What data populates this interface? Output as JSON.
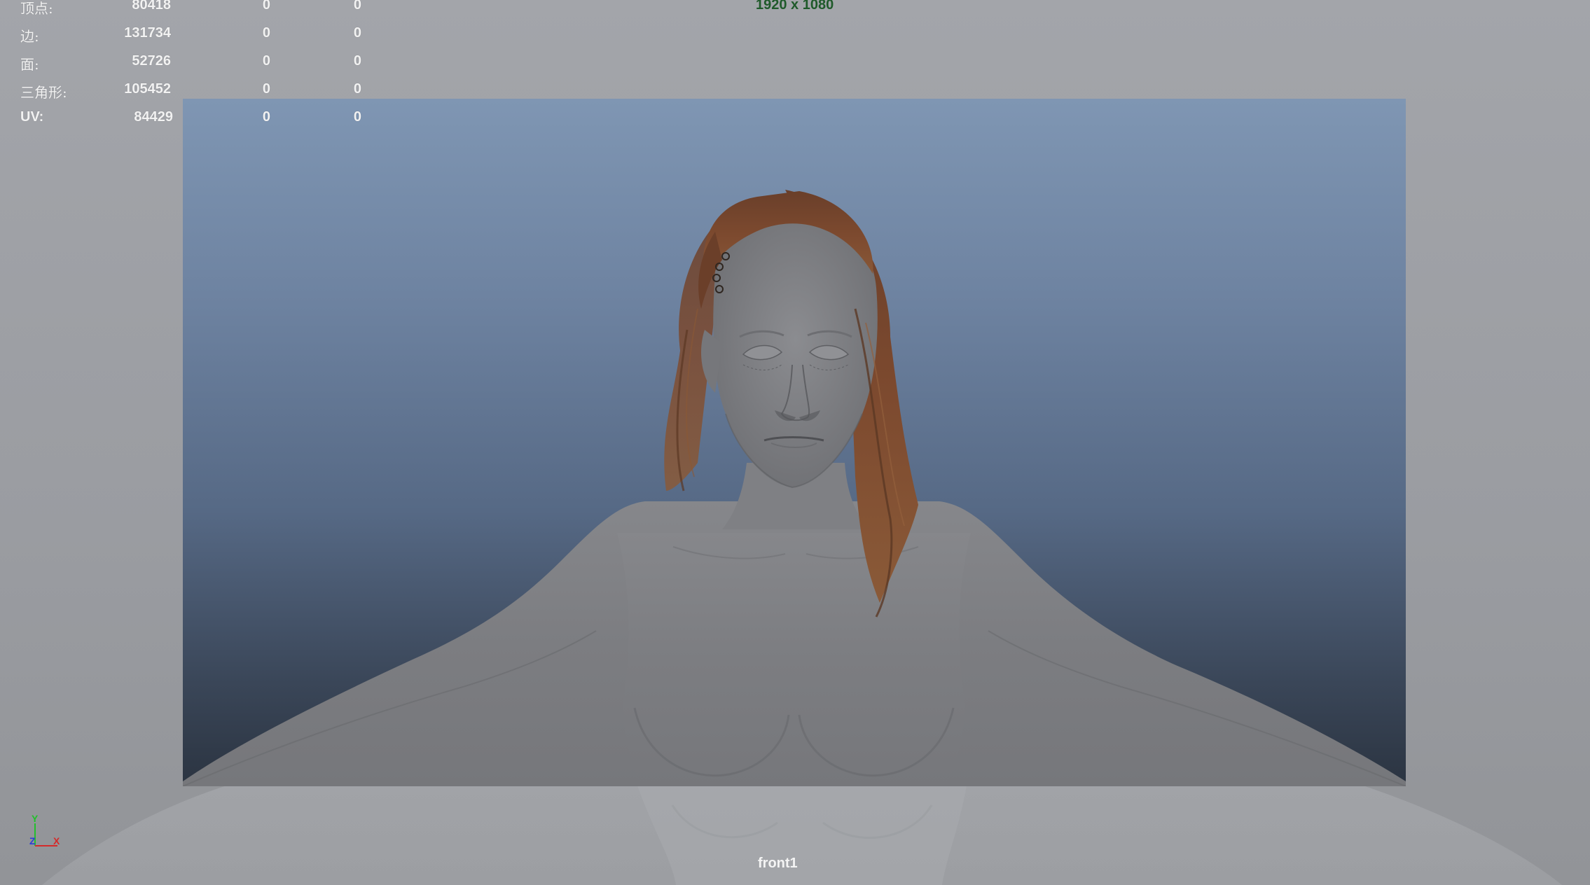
{
  "hud": {
    "rows": [
      {
        "label": "顶点:",
        "v1": "80418",
        "v2": "0",
        "v3": "0"
      },
      {
        "label": "边:",
        "v1": "131734",
        "v2": "0",
        "v3": "0"
      },
      {
        "label": "面:",
        "v1": "52726",
        "v2": "0",
        "v3": "0"
      },
      {
        "label": "三角形:",
        "v1": "105452",
        "v2": "0",
        "v3": "0"
      },
      {
        "label": "UV:",
        "v1": "84429",
        "v2": "0",
        "v3": "0"
      }
    ]
  },
  "resolution_gate": "1920 x 1080",
  "camera_name": "front1",
  "axis": {
    "y_label": "Y",
    "z_label": "Z",
    "x_label": "X",
    "y_color": "#22c02c",
    "x_color": "#d42a2a",
    "z_color": "#2a3fd4"
  },
  "colors": {
    "gate_top": "#7f96b3",
    "gate_bottom": "#2b3441",
    "resolution_text": "#1f5a2a",
    "hair": "#7a4a2e",
    "skin": "#7d7e82"
  }
}
